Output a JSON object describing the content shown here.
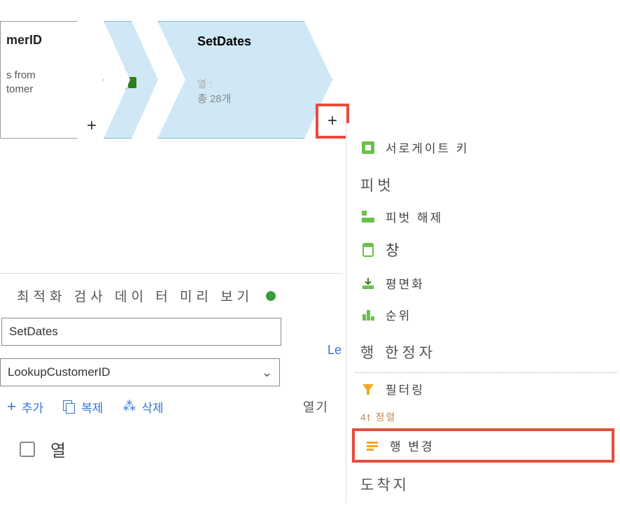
{
  "canvas": {
    "node1": {
      "title": "merID",
      "sub1": "s from",
      "sub2": "tomer"
    },
    "node2": {
      "title": "SetDates",
      "col_label": "열 :",
      "col_value": "총 28개"
    }
  },
  "panel": {
    "title": "최적화 검사 데이 터 미리 보기",
    "input_value": "SetDates",
    "dropdown_value": "LookupCustomerID",
    "add_label": "추가",
    "copy_label": "복제",
    "delete_label": "삭제",
    "open_label": "열기",
    "link_text": "Le",
    "checkbox_label": "열"
  },
  "menu": {
    "surrogate": "서로게이트 키",
    "pivot_header": "피벗",
    "unpivot": "피벗 해제",
    "window": "창",
    "flatten": "평면화",
    "rank": "순위",
    "row_limiter_header": "행 한정자",
    "filter": "필터링",
    "sort": "4t 정렬",
    "row_change": "행 변경",
    "destination": "도착지"
  }
}
